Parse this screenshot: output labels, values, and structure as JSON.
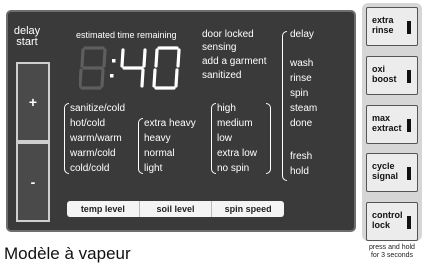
{
  "delay_start": {
    "line1": "delay",
    "line2": "start"
  },
  "plus_label": "+",
  "minus_label": "-",
  "time": {
    "label": "estimated time remaining",
    "ghost_digit": "8",
    "display": ":40"
  },
  "status_lights": [
    "door locked",
    "sensing",
    "add a garment",
    "sanitized"
  ],
  "temperatures": [
    "sanitize/cold",
    "hot/cold",
    "warm/warm",
    "warm/cold",
    "cold/cold"
  ],
  "soil_levels": [
    "extra heavy",
    "heavy",
    "normal",
    "light"
  ],
  "spin_speeds": [
    "high",
    "medium",
    "low",
    "extra low",
    "no spin"
  ],
  "cycle_status": {
    "top": "delay",
    "middle": [
      "wash",
      "rinse",
      "spin",
      "steam",
      "done"
    ],
    "bottom": [
      "fresh",
      "hold"
    ]
  },
  "tabs": [
    "temp level",
    "soil level",
    "spin speed"
  ],
  "options": [
    {
      "line1": "extra",
      "line2": "rinse"
    },
    {
      "line1": "oxi",
      "line2": "boost"
    },
    {
      "line1": "max",
      "line2": "extract"
    },
    {
      "line1": "cycle",
      "line2": "signal"
    },
    {
      "line1": "control",
      "line2": "lock"
    }
  ],
  "press_hold": {
    "line1": "press and hold",
    "line2": "for 3 seconds"
  },
  "caption": "Modèle à vapeur",
  "colors": {
    "panel": "#3a3a3a",
    "text": "#ffffff",
    "button_panel": "#d6d6d6",
    "button": "#ececec"
  }
}
